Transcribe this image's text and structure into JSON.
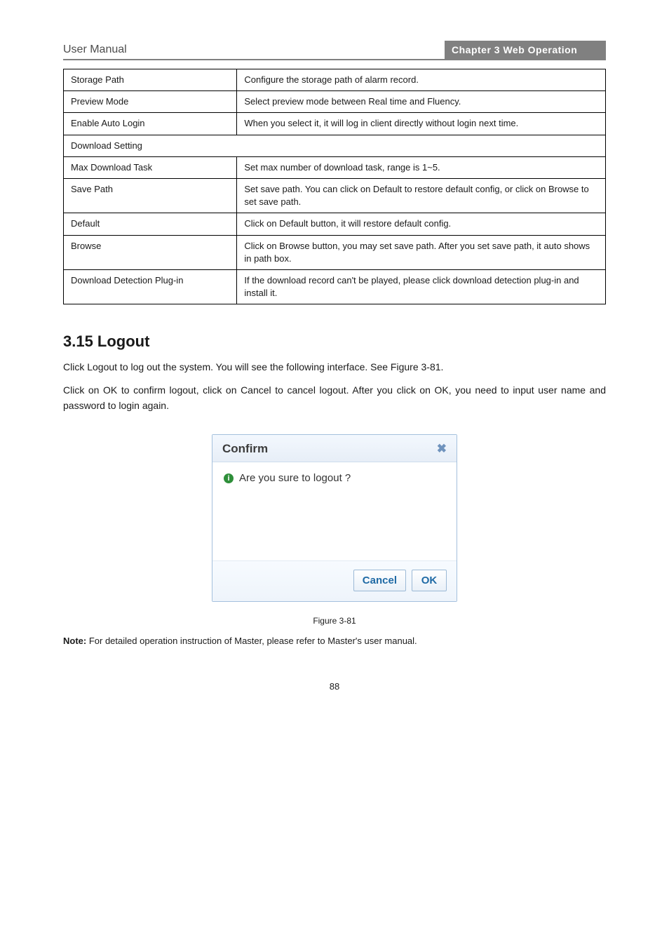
{
  "header": {
    "left": "User Manual",
    "chapter": "Chapter 3 Web Operation"
  },
  "table": {
    "rows": [
      {
        "label": "Storage Path",
        "value": "Configure the storage path of alarm record.",
        "colspan": 1
      },
      {
        "label": "Preview Mode",
        "value": "Select preview mode between Real time and Fluency.",
        "colspan": 1
      },
      {
        "label": "Enable Auto Login",
        "value": "When you select it, it will log in client directly without login next time.",
        "colspan": 1
      },
      {
        "label": "Download Setting",
        "value": "",
        "colspan": 2,
        "isSectionHeader": true
      },
      {
        "label": "Max Download Task",
        "value": "Set max number of download task, range is 1~5.",
        "colspan": 1
      },
      {
        "label": "Save Path",
        "value": "Set save path. You can click on Default to restore default config, or click on Browse to set save path.",
        "colspan": 1
      },
      {
        "label": "Default",
        "value": "Click on Default button, it will restore default config.",
        "colspan": 1
      },
      {
        "label": "Browse",
        "value": "Click on Browse button, you may set save path. After you set save path, it auto shows in path box.",
        "colspan": 1
      },
      {
        "label": "Download Detection Plug-in",
        "value": "If the download record can't be played, please click download detection plug-in and install it.",
        "colspan": 1
      }
    ]
  },
  "section": {
    "heading": "3.15 Logout",
    "para1": "Click Logout to log out the system. You will see the following interface. See Figure 3-81.",
    "para2": "Click on OK to confirm logout, click on Cancel to cancel logout. After you click on OK, you need to input user name and password to login again.",
    "figureCaption": "Figure 3-81",
    "noteLabel": "Note:",
    "noteBody": "For detailed operation instruction of Master, please refer to Master's user manual."
  },
  "dialog": {
    "title": "Confirm",
    "message": "Are you sure to logout ?",
    "cancel": "Cancel",
    "ok": "OK"
  },
  "pageNumber": "88"
}
